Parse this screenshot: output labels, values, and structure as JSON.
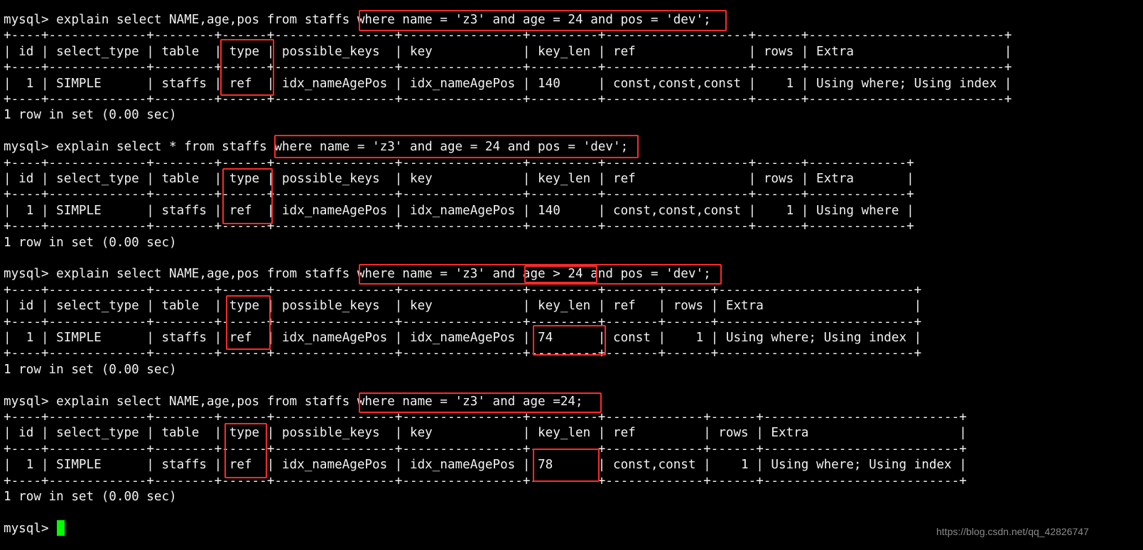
{
  "terminal": {
    "lines": [
      "mysql> explain select NAME,age,pos from staffs where name = 'z3' and age = 24 and pos = 'dev';",
      "+----+-------------+--------+------+----------------+----------------+---------+-------------------+------+--------------------------+",
      "| id | select_type | table  | type | possible_keys  | key            | key_len | ref               | rows | Extra                    |",
      "+----+-------------+--------+------+----------------+----------------+---------+-------------------+------+--------------------------+",
      "|  1 | SIMPLE      | staffs | ref  | idx_nameAgePos | idx_nameAgePos | 140     | const,const,const |    1 | Using where; Using index |",
      "+----+-------------+--------+------+----------------+----------------+---------+-------------------+------+--------------------------+",
      "1 row in set (0.00 sec)",
      "",
      "mysql> explain select * from staffs where name = 'z3' and age = 24 and pos = 'dev';",
      "+----+-------------+--------+------+----------------+----------------+---------+-------------------+------+-------------+",
      "| id | select_type | table  | type | possible_keys  | key            | key_len | ref               | rows | Extra       |",
      "+----+-------------+--------+------+----------------+----------------+---------+-------------------+------+-------------+",
      "|  1 | SIMPLE      | staffs | ref  | idx_nameAgePos | idx_nameAgePos | 140     | const,const,const |    1 | Using where |",
      "+----+-------------+--------+------+----------------+----------------+---------+-------------------+------+-------------+",
      "1 row in set (0.00 sec)",
      "",
      "mysql> explain select NAME,age,pos from staffs where name = 'z3' and age > 24 and pos = 'dev';",
      "+----+-------------+--------+------+----------------+----------------+---------+-------+------+--------------------------+",
      "| id | select_type | table  | type | possible_keys  | key            | key_len | ref   | rows | Extra                    |",
      "+----+-------------+--------+------+----------------+----------------+---------+-------+------+--------------------------+",
      "|  1 | SIMPLE      | staffs | ref  | idx_nameAgePos | idx_nameAgePos | 74      | const |    1 | Using where; Using index |",
      "+----+-------------+--------+------+----------------+----------------+---------+-------+------+--------------------------+",
      "1 row in set (0.00 sec)",
      "",
      "mysql> explain select NAME,age,pos from staffs where name = 'z3' and age =24;",
      "+----+-------------+--------+------+----------------+----------------+---------+-------------+------+--------------------------+",
      "| id | select_type | table  | type | possible_keys  | key            | key_len | ref         | rows | Extra                    |",
      "+----+-------------+--------+------+----------------+----------------+---------+-------------+------+--------------------------+",
      "|  1 | SIMPLE      | staffs | ref  | idx_nameAgePos | idx_nameAgePos | 78      | const,const |    1 | Using where; Using index |",
      "+----+-------------+--------+------+----------------+----------------+---------+-------------+------+--------------------------+",
      "1 row in set (0.00 sec)",
      "",
      "mysql> "
    ]
  },
  "watermark": "https://blog.csdn.net/qq_42826747",
  "colors": {
    "background": "#000000",
    "text": "#f2f2f2",
    "highlight_box": "#ff2a2a",
    "cursor": "#00ff00"
  }
}
